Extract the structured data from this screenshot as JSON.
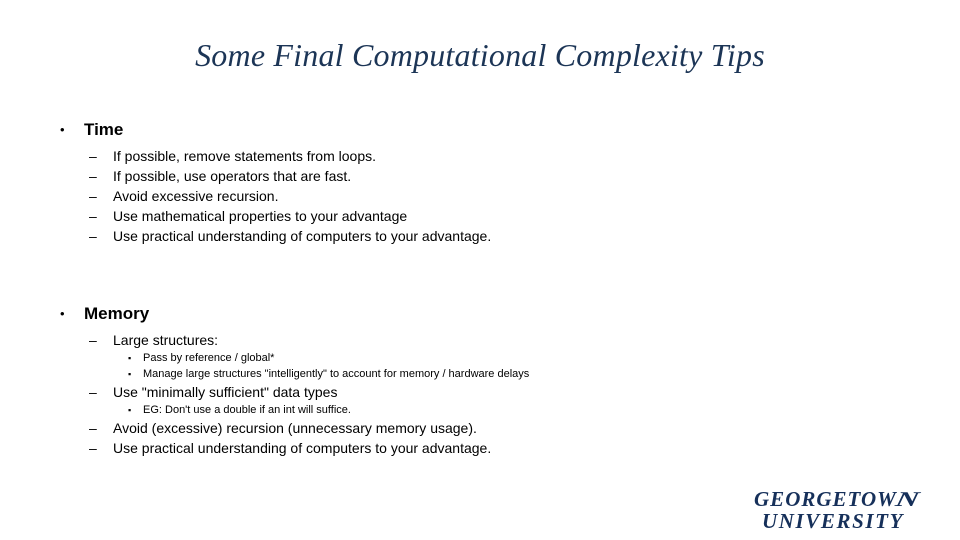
{
  "slide": {
    "title": "Some Final Computational Complexity Tips",
    "background_color": "#FFFFFF",
    "title_color": "#1C3556",
    "body_color": "#000000",
    "bullet_marks": {
      "level1": "•",
      "level2": "–",
      "level3": "▪"
    },
    "sections": [
      {
        "heading": "Time",
        "items": [
          {
            "level": 2,
            "text": "If possible, remove statements from loops."
          },
          {
            "level": 2,
            "text": "If possible, use operators that are fast."
          },
          {
            "level": 2,
            "text": "Avoid excessive recursion."
          },
          {
            "level": 2,
            "text": "Use mathematical properties to your advantage"
          },
          {
            "level": 2,
            "text": "Use practical understanding of computers to your advantage."
          }
        ]
      },
      {
        "heading": "Memory",
        "items": [
          {
            "level": 2,
            "text": "Large structures:"
          },
          {
            "level": 3,
            "text": "Pass by reference / global*"
          },
          {
            "level": 3,
            "text": "Manage large structures \"intelligently\" to account for memory / hardware delays"
          },
          {
            "level": 2,
            "text": "Use \"minimally sufficient\" data types"
          },
          {
            "level": 3,
            "text": "EG: Don't use a double if an int will suffice."
          },
          {
            "level": 2,
            "text": "Avoid (excessive) recursion (unnecessary memory usage)."
          },
          {
            "level": 2,
            "text": "Use practical understanding of computers to your advantage."
          }
        ]
      }
    ]
  },
  "logo": {
    "name": "georgetown-university-logo",
    "line1": "GEORGETOW",
    "line1_swash": "N",
    "line2": "UNIVERSITY",
    "color": "#16305A"
  }
}
